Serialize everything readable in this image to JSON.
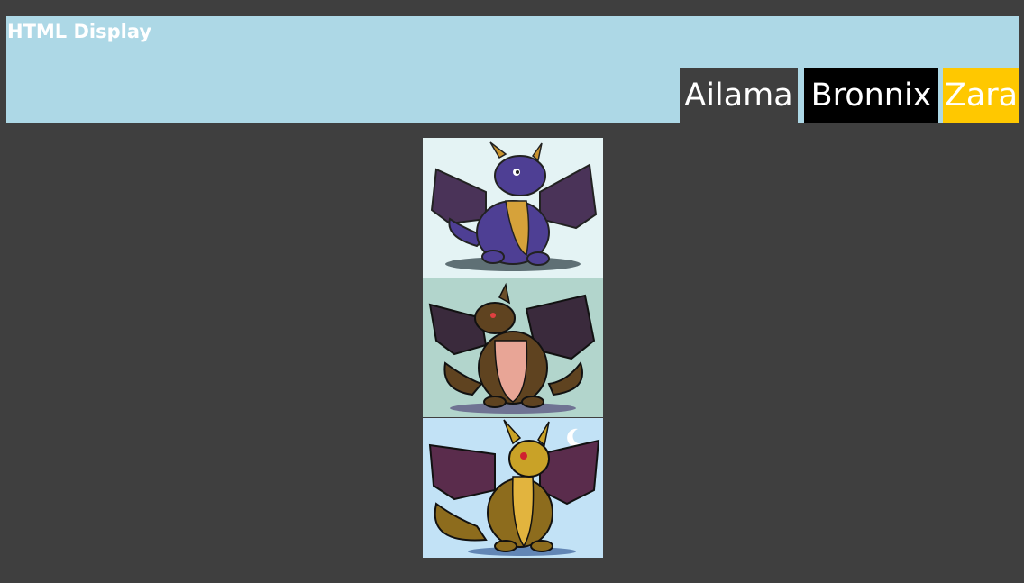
{
  "header": {
    "title": "HTML Display",
    "background": "#add8e6"
  },
  "nav": [
    {
      "label": "Ailama",
      "color": "#3f3f3f"
    },
    {
      "label": "Bronnix",
      "color": "#000000"
    },
    {
      "label": "Zara",
      "color": "#ffc800"
    }
  ],
  "gallery": [
    {
      "name": "purple dragon",
      "background": "#e4f3f4",
      "body": "#4e3f94",
      "belly": "#d6a23a",
      "wing": "#4a3358"
    },
    {
      "name": "bronze dragon",
      "background": "#b2d5cc",
      "body": "#5f4320",
      "belly": "#e8a596",
      "wing": "#3a2a3c"
    },
    {
      "name": "gold dragon",
      "background": "#c2e2f6",
      "body": "#8d6c1d",
      "belly": "#e2b43e",
      "wing": "#5a2c4c"
    }
  ]
}
